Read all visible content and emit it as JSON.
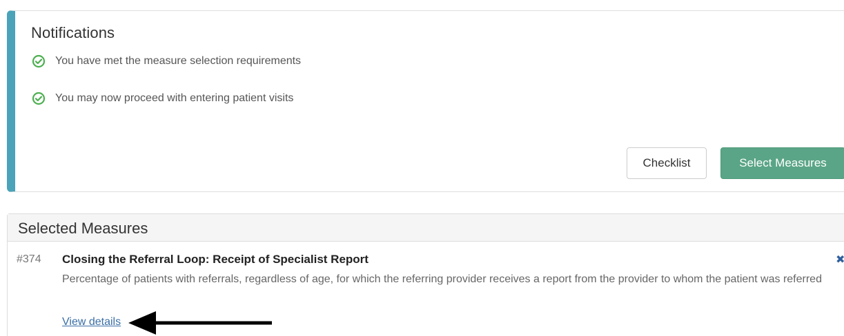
{
  "notifications": {
    "title": "Notifications",
    "items": [
      {
        "icon": "check-circle-icon",
        "text": "You have met the measure selection requirements"
      },
      {
        "icon": "check-circle-icon",
        "text": "You may now proceed with entering patient visits"
      }
    ],
    "buttons": {
      "checklist_label": "Checklist",
      "select_measures_label": "Select Measures"
    }
  },
  "selected_measures": {
    "title": "Selected Measures",
    "items": [
      {
        "number": "#374",
        "name": "Closing the Referral Loop: Receipt of Specialist Report",
        "description": "Percentage of patients with referrals, regardless of age, for which the referring provider receives a report from the provider to whom the patient was referred",
        "link_label": "View details",
        "remove_icon": "close-icon"
      }
    ]
  },
  "colors": {
    "accent_border": "#4aa3b8",
    "success_green": "#5aa587",
    "link_blue": "#3a6ea5"
  }
}
